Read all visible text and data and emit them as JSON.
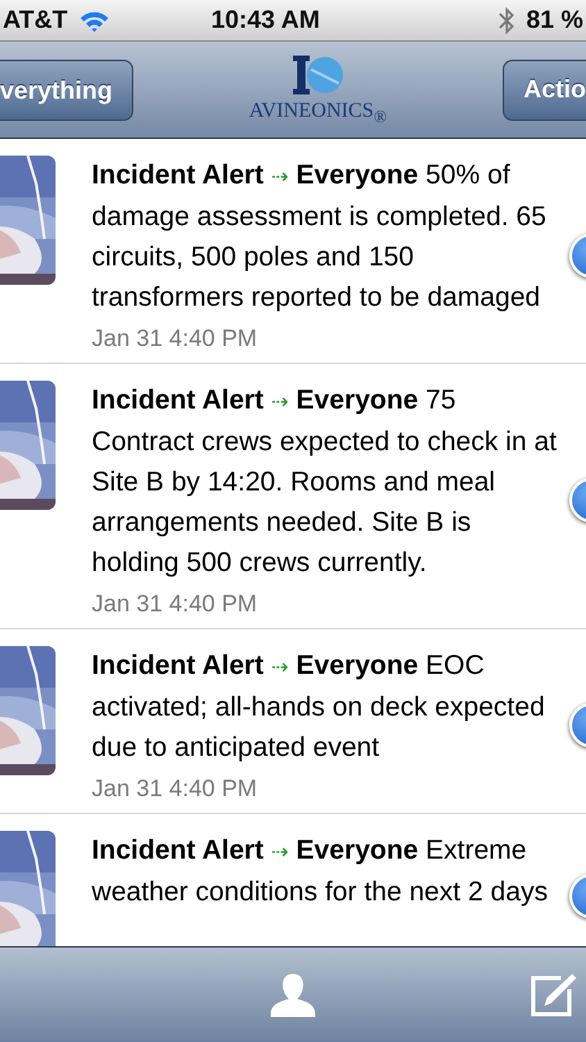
{
  "status_bar": {
    "carrier": "AT&T",
    "time": "10:43 AM",
    "battery": "81 %"
  },
  "nav_bar": {
    "left_button": "verything",
    "logo_text": "AVINEONICS$_{®}$",
    "right_button": "Actio"
  },
  "messages": [
    {
      "sender": "Incident Alert",
      "arrow": "⇢",
      "recipient": "Everyone",
      "body": "50% of damage assessment is completed. 65 circuits, 500 poles and 150 transformers reported to be damaged",
      "time": "Jan 31 4:40 PM"
    },
    {
      "sender": "Incident Alert",
      "arrow": "⇢",
      "recipient": "Everyone",
      "body": "75 Contract crews expected to check in at Site B by 14:20. Rooms and meal arrangements needed. Site B is holding 500 crews currently.",
      "time": "Jan 31 4:40 PM"
    },
    {
      "sender": "Incident Alert",
      "arrow": "⇢",
      "recipient": "Everyone",
      "body": "EOC activated; all-hands on deck expected due to anticipated event",
      "time": "Jan 31 4:40 PM"
    },
    {
      "sender": "Incident Alert",
      "arrow": "⇢",
      "recipient": "Everyone",
      "body": "Extreme weather conditions for the next 2 days"
    }
  ]
}
